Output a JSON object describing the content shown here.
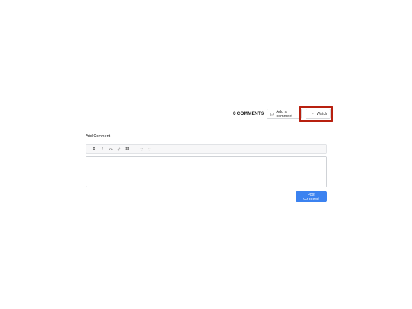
{
  "comments_header": {
    "count_label": "0 COMMENTS",
    "add_comment_label": "Add a comment",
    "watch_label": "Watch"
  },
  "form": {
    "heading": "Add Comment",
    "toolbar": {
      "bold_glyph": "B",
      "italic_glyph": "I",
      "code_glyph": "<>",
      "quote_glyph": "99"
    },
    "editor_value": "",
    "submit_label": "Post comment"
  },
  "colors": {
    "highlight_border": "#b8200f",
    "primary_button": "#3b82f0"
  }
}
